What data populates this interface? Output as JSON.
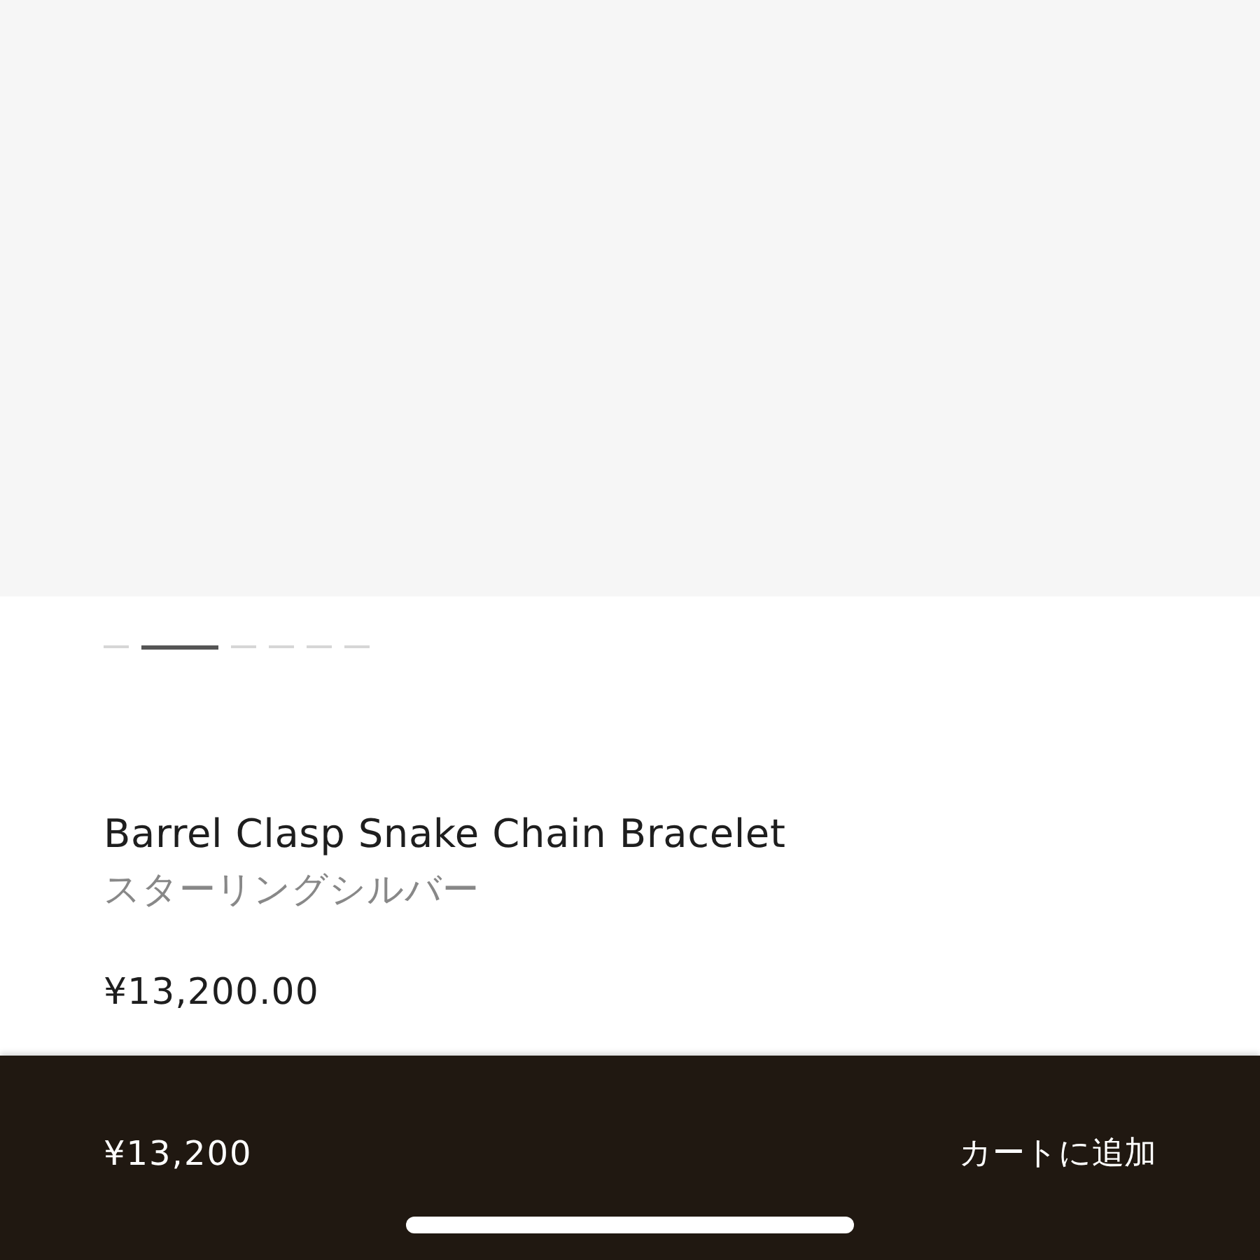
{
  "gallery": {
    "pages": [
      {
        "selected": false
      },
      {
        "selected": true
      },
      {
        "selected": false
      },
      {
        "selected": false
      },
      {
        "selected": false
      },
      {
        "selected": false
      }
    ]
  },
  "product": {
    "name": "Barrel Clasp Snake Chain Bracelet",
    "material": "スターリングシルバー",
    "price": "¥13,200.00"
  },
  "cart_bar": {
    "price": "¥13,200",
    "button": "カートに追加"
  }
}
